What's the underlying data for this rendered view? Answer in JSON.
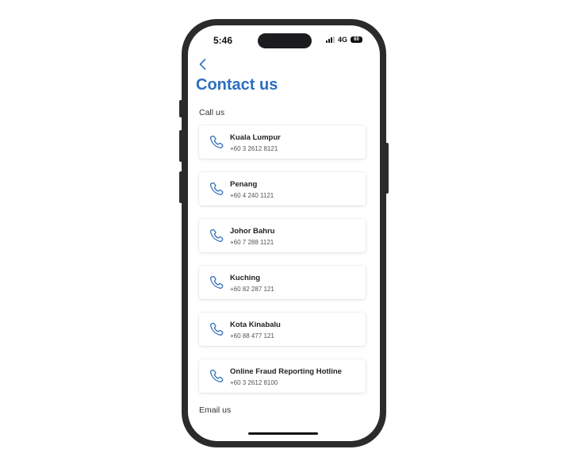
{
  "status_bar": {
    "time": "5:46",
    "network": "4G",
    "battery": "60"
  },
  "header": {
    "back_icon": "chevron-left-icon",
    "title": "Contact us"
  },
  "sections": {
    "call_us": "Call us",
    "email_us": "Email us"
  },
  "call_items": [
    {
      "city": "Kuala Lumpur",
      "number": "+60 3 2612 8121"
    },
    {
      "city": "Penang",
      "number": "+60 4 240 1121"
    },
    {
      "city": "Johor Bahru",
      "number": "+60 7 288 1121"
    },
    {
      "city": "Kuching",
      "number": "+60 82 287 121"
    },
    {
      "city": "Kota Kinabalu",
      "number": "+60 88 477 121"
    },
    {
      "city": "Online Fraud Reporting Hotline",
      "number": "+60 3 2612 8100"
    }
  ],
  "colors": {
    "accent": "#2b6fc2",
    "icon": "#2f6db5",
    "frame": "#2b2b2d"
  }
}
